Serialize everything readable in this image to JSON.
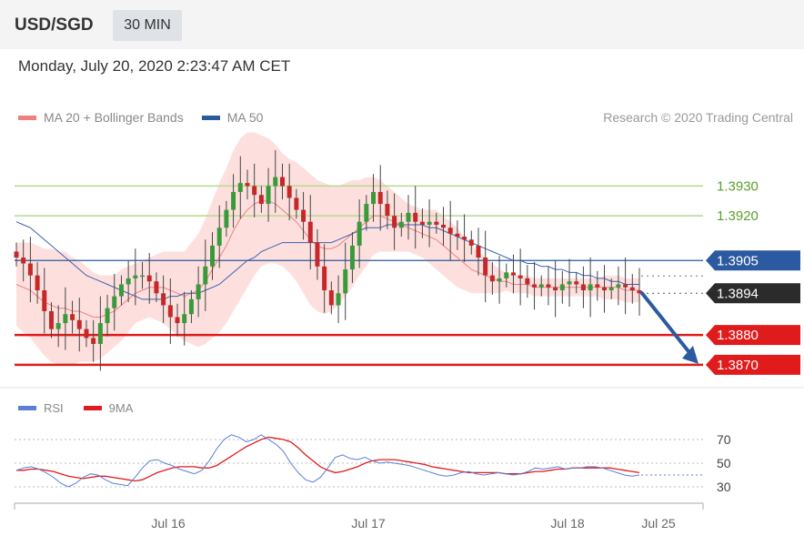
{
  "header": {
    "symbol": "USD/SGD",
    "timeframe": "30 MIN"
  },
  "datetime": "Monday, July 20, 2020 2:23:47 AM CET",
  "legend": {
    "bb": "MA 20 + Bollinger Bands",
    "ma50": "MA 50",
    "rsi": "RSI",
    "rsi_ma": "9MA",
    "bb_color": "#f08080",
    "ma50_color": "#2c5aa0",
    "rsi_color": "#5b7fd6",
    "rsi_ma_color": "#e01b1b"
  },
  "credit": "Research © 2020 Trading Central",
  "chart_data": {
    "type": "line",
    "x_ticks": [
      "Jul 16",
      "Jul 17",
      "Jul 18",
      "Jul 25"
    ],
    "ylim": [
      1.3866,
      1.3946
    ],
    "rsi_ylim": [
      20,
      80
    ],
    "rsi_ticks": [
      "70",
      "50",
      "30"
    ],
    "levels": [
      {
        "label": "1.3930",
        "value": 1.393,
        "kind": "resistance"
      },
      {
        "label": "1.3920",
        "value": 1.392,
        "kind": "resistance"
      },
      {
        "label": "1.3905",
        "value": 1.3905,
        "kind": "pivot"
      },
      {
        "label": "1.3894",
        "value": 1.3894,
        "kind": "last"
      },
      {
        "label": "1.3880",
        "value": 1.388,
        "kind": "support"
      },
      {
        "label": "1.3870",
        "value": 1.387,
        "kind": "support"
      }
    ],
    "price": [
      1.3906,
      1.3904,
      1.39,
      1.3895,
      1.3888,
      1.3882,
      1.3884,
      1.3887,
      1.3885,
      1.3882,
      1.3879,
      1.3877,
      1.3884,
      1.3889,
      1.3893,
      1.3897,
      1.3899,
      1.39,
      1.39,
      1.3898,
      1.3894,
      1.389,
      1.3886,
      1.3884,
      1.3887,
      1.3892,
      1.3897,
      1.3903,
      1.391,
      1.3916,
      1.3922,
      1.3928,
      1.3931,
      1.393,
      1.3927,
      1.3924,
      1.393,
      1.3933,
      1.393,
      1.3926,
      1.3922,
      1.3918,
      1.3911,
      1.3903,
      1.3895,
      1.389,
      1.3894,
      1.3902,
      1.391,
      1.3918,
      1.3924,
      1.3928,
      1.3924,
      1.392,
      1.3916,
      1.3918,
      1.3921,
      1.3918,
      1.3917,
      1.3918,
      1.3917,
      1.3916,
      1.3914,
      1.3913,
      1.3912,
      1.391,
      1.3906,
      1.39,
      1.3898,
      1.3899,
      1.3901,
      1.39,
      1.3899,
      1.3897,
      1.3896,
      1.3897,
      1.3896,
      1.3895,
      1.3897,
      1.3898,
      1.3897,
      1.3895,
      1.3897,
      1.3896,
      1.3895,
      1.3896,
      1.3897,
      1.3896,
      1.3895,
      1.3894
    ],
    "ma20": [
      1.3897,
      1.3896,
      1.3895,
      1.3893,
      1.3891,
      1.389,
      1.3889,
      1.3889,
      1.3888,
      1.3888,
      1.3887,
      1.3886,
      1.3886,
      1.3887,
      1.3888,
      1.389,
      1.3892,
      1.3894,
      1.3895,
      1.3896,
      1.3896,
      1.3896,
      1.3895,
      1.3894,
      1.3893,
      1.3894,
      1.3895,
      1.3898,
      1.3902,
      1.3906,
      1.391,
      1.3915,
      1.3919,
      1.3922,
      1.3924,
      1.3925,
      1.3925,
      1.3924,
      1.3922,
      1.392,
      1.3918,
      1.3915,
      1.3912,
      1.391,
      1.3909,
      1.3909,
      1.391,
      1.3912,
      1.3914,
      1.3916,
      1.3918,
      1.392,
      1.392,
      1.3919,
      1.3918,
      1.3917,
      1.3916,
      1.3915,
      1.3914,
      1.3913,
      1.3912,
      1.391,
      1.3908,
      1.3906,
      1.3904,
      1.3902,
      1.3901,
      1.39,
      1.3899,
      1.3898,
      1.3898,
      1.3897,
      1.3897,
      1.3897,
      1.3896,
      1.3896,
      1.3896,
      1.3896,
      1.3896,
      1.3896,
      1.3896,
      1.3896,
      1.3896,
      1.3896,
      1.3896,
      1.3896,
      1.3896,
      1.3895,
      1.3895,
      1.3895
    ],
    "ma50": [
      1.3918,
      1.3917,
      1.3916,
      1.3914,
      1.3912,
      1.391,
      1.3908,
      1.3906,
      1.3904,
      1.3902,
      1.39,
      1.3899,
      1.3898,
      1.3897,
      1.3896,
      1.3895,
      1.3894,
      1.3893,
      1.3892,
      1.3892,
      1.3892,
      1.3892,
      1.3893,
      1.3893,
      1.3894,
      1.3894,
      1.3894,
      1.3895,
      1.3896,
      1.3897,
      1.3899,
      1.3901,
      1.3903,
      1.3905,
      1.3906,
      1.3908,
      1.3909,
      1.391,
      1.3911,
      1.3911,
      1.3911,
      1.3911,
      1.3911,
      1.3911,
      1.3911,
      1.3911,
      1.3912,
      1.3913,
      1.3914,
      1.3915,
      1.3916,
      1.3916,
      1.3916,
      1.3917,
      1.3917,
      1.3917,
      1.3917,
      1.3917,
      1.3917,
      1.3916,
      1.3916,
      1.3915,
      1.3914,
      1.3913,
      1.3912,
      1.3911,
      1.391,
      1.3909,
      1.3908,
      1.3907,
      1.3906,
      1.3905,
      1.3905,
      1.3904,
      1.3904,
      1.3903,
      1.3903,
      1.3902,
      1.3902,
      1.3901,
      1.3901,
      1.39,
      1.39,
      1.3899,
      1.3899,
      1.3898,
      1.3898,
      1.3897,
      1.3897,
      1.3897
    ],
    "bb_width": [
      0.0014,
      0.0015,
      0.0016,
      0.0017,
      0.0018,
      0.0019,
      0.0019,
      0.0019,
      0.0018,
      0.0017,
      0.0016,
      0.0015,
      0.0014,
      0.0013,
      0.0012,
      0.0012,
      0.0011,
      0.001,
      0.001,
      0.001,
      0.0011,
      0.0012,
      0.0013,
      0.0014,
      0.0015,
      0.0017,
      0.0019,
      0.0021,
      0.0023,
      0.0025,
      0.0026,
      0.0027,
      0.0027,
      0.0026,
      0.0024,
      0.0022,
      0.0021,
      0.002,
      0.0019,
      0.0019,
      0.002,
      0.0021,
      0.0022,
      0.0022,
      0.0022,
      0.0021,
      0.002,
      0.0019,
      0.0018,
      0.0016,
      0.0015,
      0.0013,
      0.0012,
      0.0011,
      0.001,
      0.0009,
      0.0008,
      0.0008,
      0.0008,
      0.0009,
      0.001,
      0.001,
      0.001,
      0.001,
      0.0009,
      0.0008,
      0.0007,
      0.0006,
      0.0005,
      0.0004,
      0.0003,
      0.0003,
      0.0003,
      0.0003,
      0.0003,
      0.0003,
      0.0003,
      0.0003,
      0.0003,
      0.0003,
      0.0003,
      0.0003,
      0.0003,
      0.0003,
      0.0004,
      0.0004,
      0.0004,
      0.0004,
      0.0004,
      0.0004
    ],
    "rsi": [
      44,
      46,
      47,
      45,
      42,
      38,
      33,
      30,
      33,
      38,
      41,
      40,
      36,
      33,
      32,
      31,
      38,
      46,
      52,
      53,
      50,
      48,
      45,
      43,
      41,
      44,
      52,
      62,
      70,
      74,
      72,
      68,
      70,
      74,
      70,
      66,
      60,
      50,
      42,
      36,
      34,
      38,
      46,
      55,
      57,
      54,
      53,
      55,
      52,
      50,
      51,
      50,
      49,
      48,
      46,
      44,
      42,
      40,
      39,
      40,
      42,
      43,
      41,
      40,
      41,
      42,
      41,
      40,
      41,
      43,
      46,
      45,
      46,
      47,
      45,
      46,
      46,
      47,
      47,
      46,
      44,
      42,
      40,
      39,
      40
    ],
    "rsi_ma": [
      44,
      44,
      45,
      45,
      44,
      43,
      41,
      39,
      38,
      37,
      38,
      39,
      39,
      38,
      37,
      36,
      35,
      36,
      39,
      42,
      44,
      46,
      47,
      47,
      47,
      46,
      46,
      48,
      52,
      56,
      60,
      64,
      67,
      70,
      72,
      71,
      70,
      68,
      63,
      57,
      52,
      47,
      44,
      42,
      43,
      45,
      47,
      50,
      52,
      53,
      53,
      53,
      52,
      51,
      50,
      49,
      47,
      46,
      45,
      44,
      43,
      42,
      42,
      42,
      42,
      42,
      41,
      41,
      41,
      42,
      43,
      43,
      44,
      45,
      45,
      46,
      46,
      46,
      46,
      46,
      46,
      45,
      44,
      43,
      42
    ],
    "forecast_arrow": {
      "from_value": 1.3894,
      "to_value": 1.387
    }
  }
}
